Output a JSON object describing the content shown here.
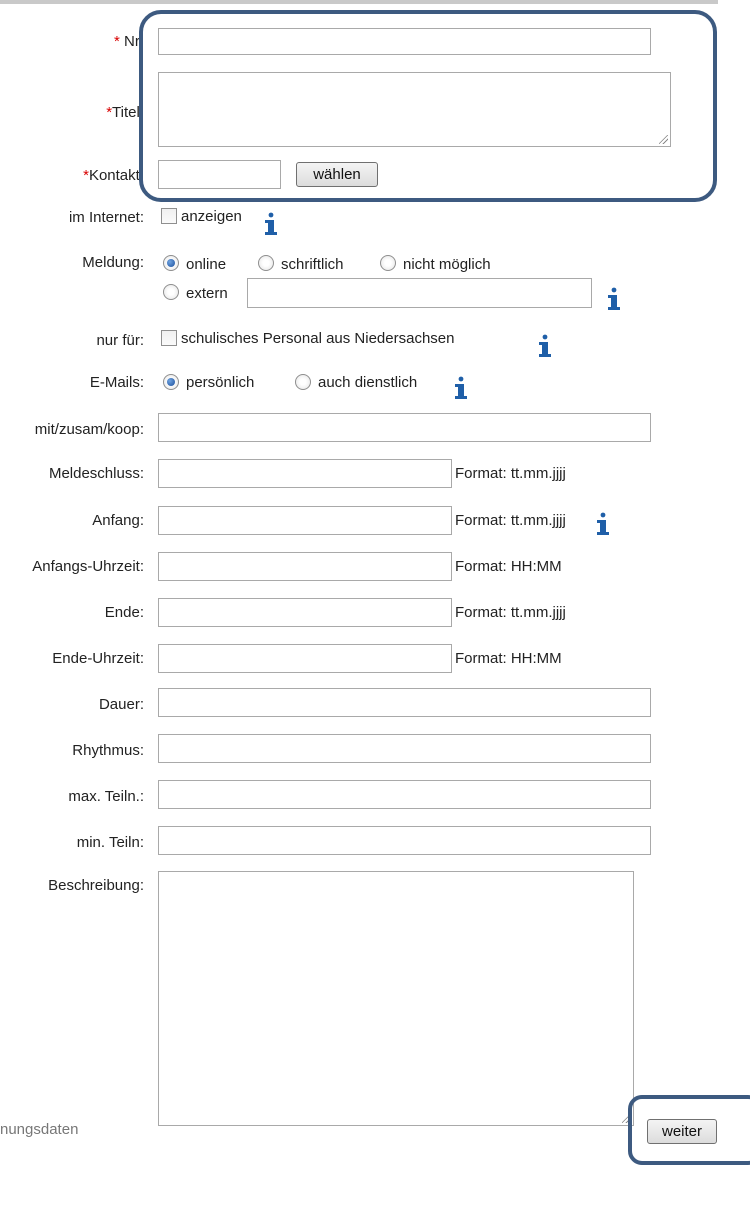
{
  "form": {
    "nr": {
      "label_req": "*",
      "label": " Nr:",
      "value": ""
    },
    "titel": {
      "label_req": "*",
      "label": "Titel:",
      "value": ""
    },
    "kontakt": {
      "label_req": "*",
      "label": "Kontakt:",
      "value": "",
      "button": "wählen"
    },
    "internet": {
      "label": "im Internet:",
      "option": "anzeigen",
      "checked": false
    },
    "meldung": {
      "label": "Meldung:",
      "options": [
        "online",
        "schriftlich",
        "nicht möglich",
        "extern"
      ],
      "selected": "online",
      "extern_value": ""
    },
    "nur_fuer": {
      "label": "nur für:",
      "option": "schulisches Personal aus Niedersachsen",
      "checked": false
    },
    "emails": {
      "label": "E-Mails:",
      "options": [
        "persönlich",
        "auch dienstlich"
      ],
      "selected": "persönlich"
    },
    "mit": {
      "label": "mit/zusam/koop:",
      "value": ""
    },
    "meldeschluss": {
      "label": "Meldeschluss:",
      "value": "",
      "format": "Format: tt.mm.jjjj"
    },
    "anfang": {
      "label": "Anfang:",
      "value": "",
      "format": "Format: tt.mm.jjjj"
    },
    "anfangs_uhrzeit": {
      "label": "Anfangs-Uhrzeit:",
      "value": "",
      "format": "Format: HH:MM"
    },
    "ende": {
      "label": "Ende:",
      "value": "",
      "format": "Format: tt.mm.jjjj"
    },
    "ende_uhrzeit": {
      "label": "Ende-Uhrzeit:",
      "value": "",
      "format": "Format: HH:MM"
    },
    "dauer": {
      "label": "Dauer:",
      "value": ""
    },
    "rhythmus": {
      "label": "Rhythmus:",
      "value": ""
    },
    "max_teiln": {
      "label": "max. Teiln.:",
      "value": ""
    },
    "min_teiln": {
      "label": "min. Teiln:",
      "value": ""
    },
    "beschreibung": {
      "label": "Beschreibung:",
      "value": ""
    }
  },
  "footer": {
    "left_text": "nungsdaten",
    "next_button": "weiter"
  },
  "icons": {
    "info": "info-icon"
  },
  "colors": {
    "required": "#d80000",
    "highlight": "#3d5a80",
    "info": "#1f5fa8"
  }
}
